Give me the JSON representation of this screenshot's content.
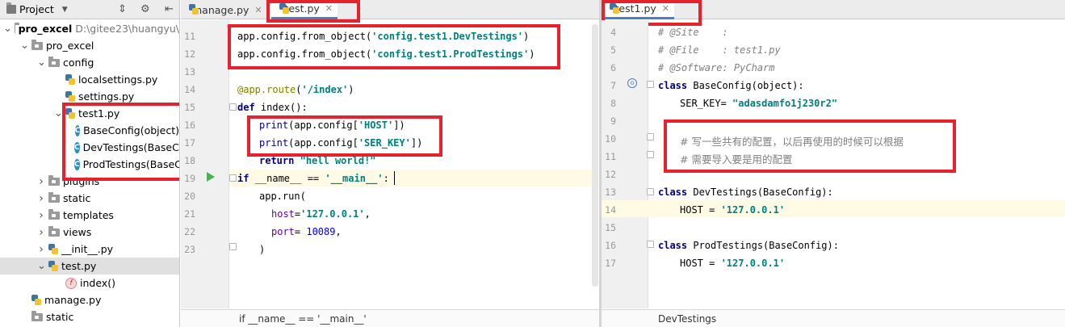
{
  "project_panel": {
    "title": "Project",
    "tree": [
      {
        "label": "pro_excel",
        "path": "D:\\gitee23\\huangyu\\",
        "kind": "folder",
        "level": 0,
        "arrow": "down",
        "bold": true
      },
      {
        "label": "pro_excel",
        "kind": "folder",
        "level": 1,
        "arrow": "down"
      },
      {
        "label": "config",
        "kind": "folder",
        "level": 2,
        "arrow": "down"
      },
      {
        "label": "localsettings.py",
        "kind": "py",
        "level": 3
      },
      {
        "label": "settings.py",
        "kind": "py",
        "level": 3
      },
      {
        "label": "test1.py",
        "kind": "py",
        "level": 3,
        "arrow": "down"
      },
      {
        "label": "BaseConfig(object)",
        "kind": "class",
        "level": 4
      },
      {
        "label": "DevTestings(BaseConfig)",
        "kind": "class",
        "level": 4
      },
      {
        "label": "ProdTestings(BaseConfig)",
        "kind": "class",
        "level": 4
      },
      {
        "label": "plugins",
        "kind": "folder",
        "level": 2,
        "arrow": "right"
      },
      {
        "label": "static",
        "kind": "folder",
        "level": 2,
        "arrow": "right"
      },
      {
        "label": "templates",
        "kind": "folder",
        "level": 2,
        "arrow": "right"
      },
      {
        "label": "views",
        "kind": "folder",
        "level": 2,
        "arrow": "right"
      },
      {
        "label": "__init__.py",
        "kind": "py",
        "level": 2,
        "arrow": "right"
      },
      {
        "label": "test.py",
        "kind": "py",
        "level": 2,
        "arrow": "down",
        "selected": true
      },
      {
        "label": "index()",
        "kind": "function",
        "level": 3
      },
      {
        "label": "manage.py",
        "kind": "py",
        "level": 1
      },
      {
        "label": "static",
        "kind": "folder",
        "level": 1
      }
    ]
  },
  "left_editor": {
    "tabs": [
      {
        "label": "manage.py",
        "active": false
      },
      {
        "label": "test.py",
        "active": true
      }
    ],
    "breadcrumb": "if __name__ == '__main__'",
    "lines": [
      {
        "n": "11",
        "text": "app.config.from_object('config.test1.DevTestings')"
      },
      {
        "n": "12",
        "text": "app.config.from_object('config.test1.ProdTestings')"
      },
      {
        "n": "13",
        "text": ""
      },
      {
        "n": "14",
        "text": "@app.route('/index')"
      },
      {
        "n": "15",
        "text": "def index():"
      },
      {
        "n": "16",
        "text": "print(app.config['HOST'])"
      },
      {
        "n": "17",
        "text": "print(app.config['SER_KEY'])"
      },
      {
        "n": "18",
        "text": "return \"hell world!\""
      },
      {
        "n": "19",
        "text": "if __name__ == '__main__':"
      },
      {
        "n": "20",
        "text": "app.run("
      },
      {
        "n": "21",
        "text": "host='127.0.0.1',"
      },
      {
        "n": "22",
        "text": "port= 10089,"
      },
      {
        "n": "23",
        "text": ")"
      }
    ]
  },
  "right_editor": {
    "tabs": [
      {
        "label": "test1.py",
        "active": true
      }
    ],
    "breadcrumb": "DevTestings",
    "lines": [
      {
        "n": "4",
        "text": "# @Site    :"
      },
      {
        "n": "5",
        "text": "# @File    : test1.py"
      },
      {
        "n": "6",
        "text": "# @Software: PyCharm"
      },
      {
        "n": "7",
        "text": "class BaseConfig(object):"
      },
      {
        "n": "8",
        "text": "SER_KEY= \"adasdamfo1j230r2\""
      },
      {
        "n": "9",
        "text": ""
      },
      {
        "n": "10",
        "text": "# 写一些共有的配置，以后再使用的时候可以根据"
      },
      {
        "n": "11",
        "text": "# 需要导入要是用的配置"
      },
      {
        "n": "12",
        "text": ""
      },
      {
        "n": "13",
        "text": "class DevTestings(BaseConfig):"
      },
      {
        "n": "14",
        "text": "HOST = '127.0.0.1'"
      },
      {
        "n": "15",
        "text": ""
      },
      {
        "n": "16",
        "text": "class ProdTestings(BaseConfig):"
      },
      {
        "n": "17",
        "text": "HOST = '127.0.0.1'"
      }
    ]
  },
  "colors": {
    "highlight_box": "#e5232f",
    "current_line": "#fffae3",
    "keyword": "#000080",
    "string": "#008080"
  }
}
